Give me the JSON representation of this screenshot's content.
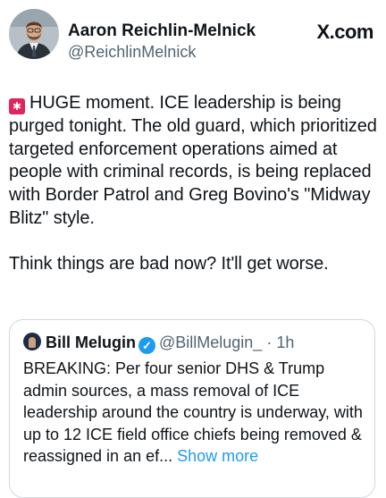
{
  "author": {
    "display_name": "Aaron Reichlin-Melnick",
    "handle": "@ReichlinMelnick"
  },
  "brand": "X.com",
  "tweet": {
    "emoji": "🚨",
    "paragraph1": "HUGE moment. ICE leadership is being purged tonight. The old guard, which prioritized targeted enforcement operations aimed at people with criminal records, is being replaced with Border Patrol and Greg Bovino's \"Midway Blitz\" style.",
    "paragraph2": "Think things are bad now? It'll get worse."
  },
  "quoted": {
    "display_name": "Bill Melugin",
    "handle_time": "@BillMelugin_ · 1h",
    "text": "BREAKING: Per four senior DHS & Trump admin sources, a mass removal of ICE leadership around the country is underway, with up to 12 ICE field office chiefs being removed & reassigned in an ef...",
    "show_more": "Show more"
  },
  "colors": {
    "text": "#0f1419",
    "secondary": "#536471",
    "link": "#1d9bf0",
    "border": "#cfd9de",
    "siren": "#e0245e"
  },
  "icons": {
    "avatar": "author-avatar-photo",
    "quoted_avatar": "quoted-avatar-photo",
    "verified": "verified-badge-icon",
    "siren": "rotating-light-emoji"
  }
}
